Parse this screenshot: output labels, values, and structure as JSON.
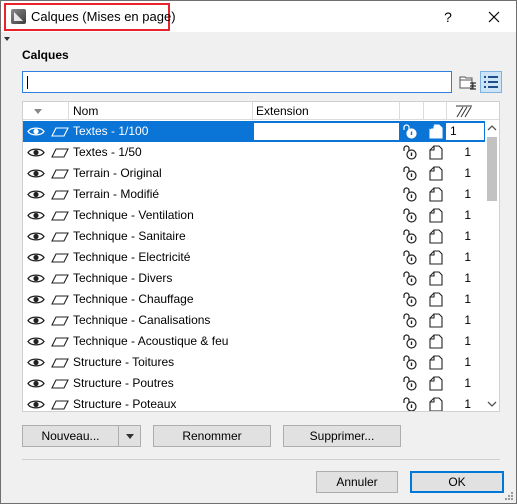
{
  "window": {
    "title": "Calques (Mises en page)",
    "help_label": "?",
    "accent_color": "#0a74d7",
    "highlight_color": "#e8232b"
  },
  "section": {
    "title": "Calques"
  },
  "search": {
    "value": "",
    "placeholder": ""
  },
  "table": {
    "headers": {
      "name": "Nom",
      "extension": "Extension"
    },
    "rows": [
      {
        "name": "Textes - 1/100",
        "extension": "",
        "number": "1",
        "selected": true,
        "lock_icon": "lock-open-icon",
        "page_icon": "page-icon"
      },
      {
        "name": "Textes - 1/50",
        "extension": "",
        "number": "1",
        "selected": false,
        "lock_icon": "lock-open-icon",
        "page_icon": "page-icon"
      },
      {
        "name": "Terrain - Original",
        "extension": "",
        "number": "1",
        "selected": false,
        "lock_icon": "lock-open-icon",
        "page_icon": "page-icon"
      },
      {
        "name": "Terrain - Modifié",
        "extension": "",
        "number": "1",
        "selected": false,
        "lock_icon": "lock-open-icon",
        "page_icon": "page-icon"
      },
      {
        "name": "Technique - Ventilation",
        "extension": "",
        "number": "1",
        "selected": false,
        "lock_icon": "lock-open-icon",
        "page_icon": "page-icon"
      },
      {
        "name": "Technique - Sanitaire",
        "extension": "",
        "number": "1",
        "selected": false,
        "lock_icon": "lock-open-icon",
        "page_icon": "page-icon"
      },
      {
        "name": "Technique - Electricité",
        "extension": "",
        "number": "1",
        "selected": false,
        "lock_icon": "lock-open-icon",
        "page_icon": "page-icon"
      },
      {
        "name": "Technique - Divers",
        "extension": "",
        "number": "1",
        "selected": false,
        "lock_icon": "lock-open-icon",
        "page_icon": "page-icon"
      },
      {
        "name": "Technique - Chauffage",
        "extension": "",
        "number": "1",
        "selected": false,
        "lock_icon": "lock-open-icon",
        "page_icon": "page-icon"
      },
      {
        "name": "Technique - Canalisations",
        "extension": "",
        "number": "1",
        "selected": false,
        "lock_icon": "lock-open-icon",
        "page_icon": "page-icon"
      },
      {
        "name": "Technique - Acoustique & feu",
        "extension": "",
        "number": "1",
        "selected": false,
        "lock_icon": "lock-open-icon",
        "page_icon": "page-icon"
      },
      {
        "name": "Structure - Toitures",
        "extension": "",
        "number": "1",
        "selected": false,
        "lock_icon": "lock-open-icon",
        "page_icon": "page-icon"
      },
      {
        "name": "Structure - Poutres",
        "extension": "",
        "number": "1",
        "selected": false,
        "lock_icon": "lock-open-icon",
        "page_icon": "page-icon"
      },
      {
        "name": "Structure - Poteaux",
        "extension": "",
        "number": "1",
        "selected": false,
        "lock_icon": "lock-open-icon",
        "page_icon": "page-icon"
      }
    ]
  },
  "buttons": {
    "new": "Nouveau...",
    "rename": "Renommer",
    "delete": "Supprimer...",
    "cancel": "Annuler",
    "ok": "OK"
  }
}
